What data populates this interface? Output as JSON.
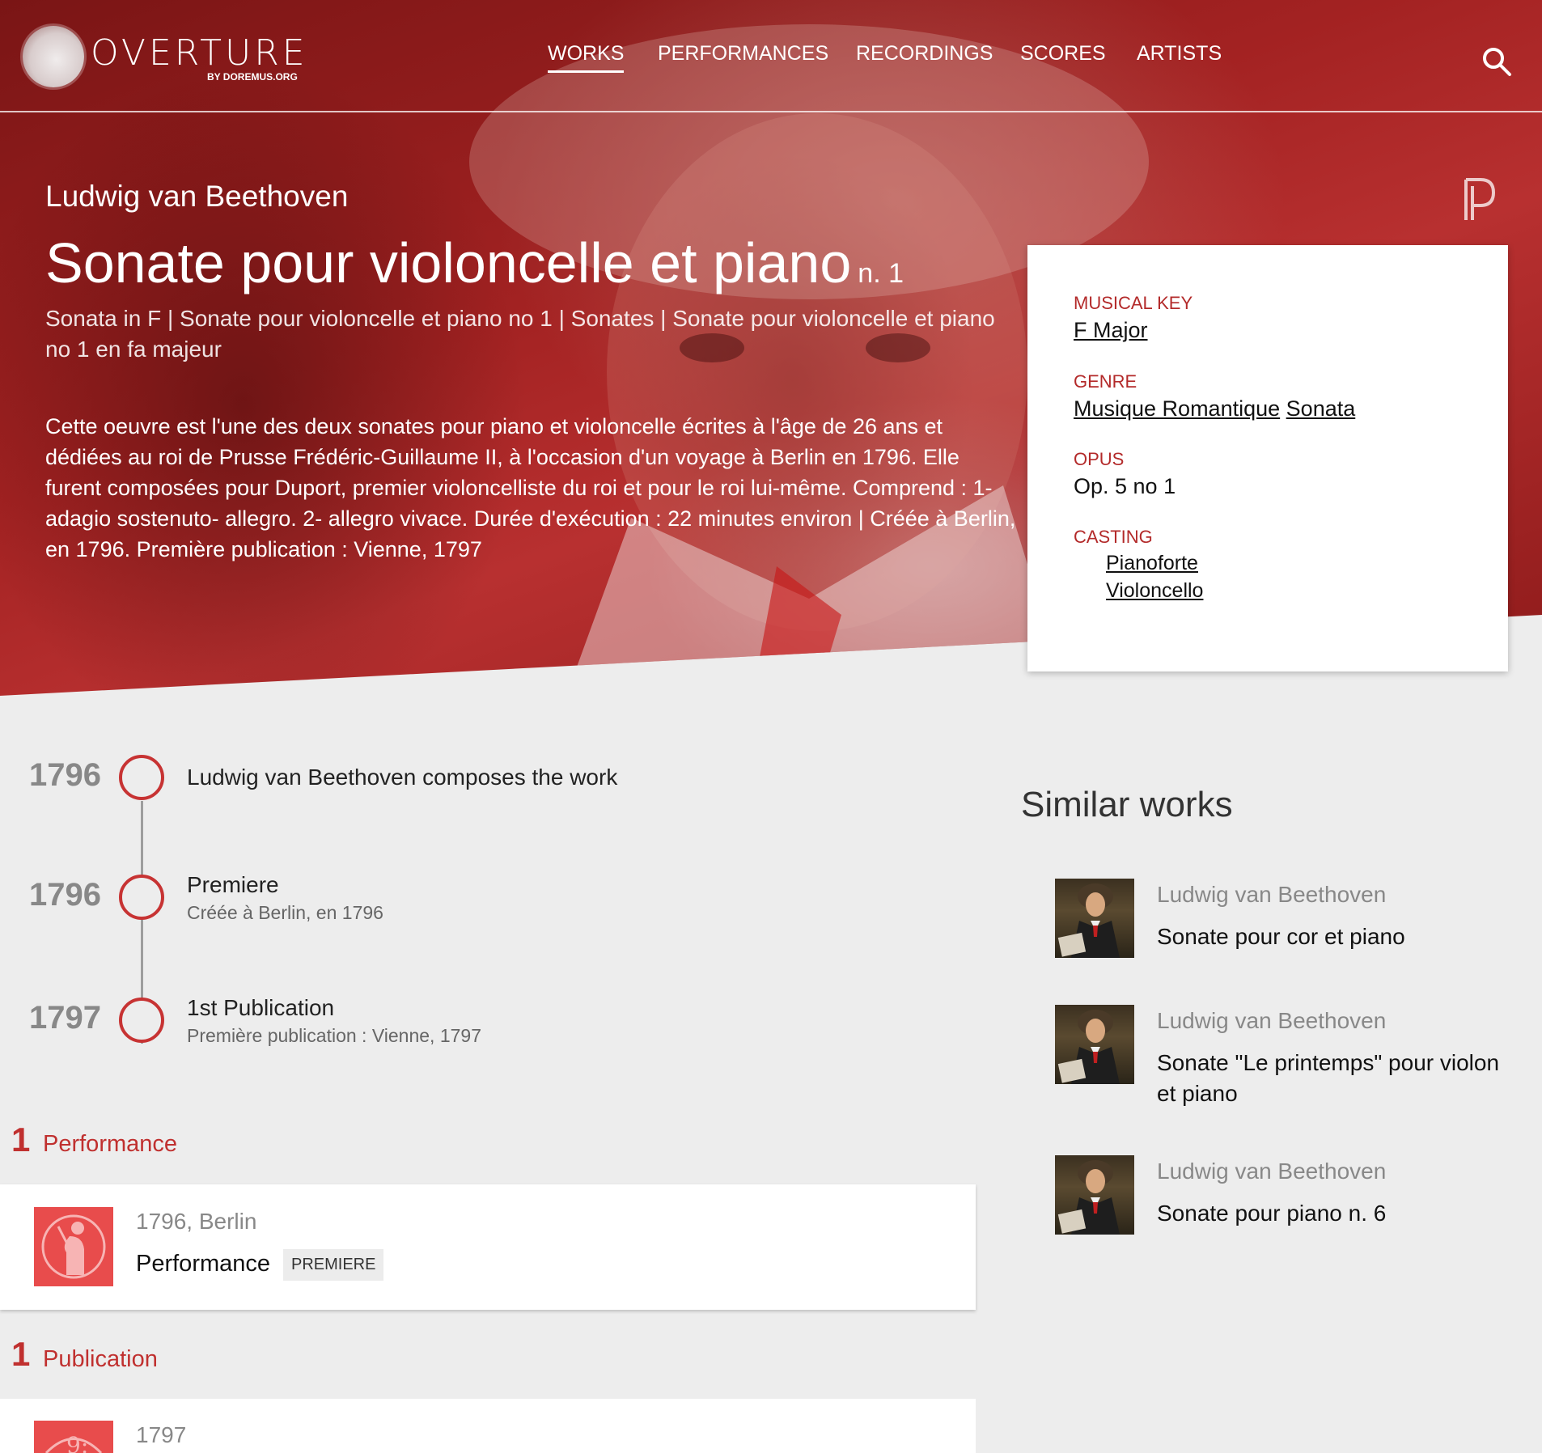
{
  "header": {
    "logo_text": "OVERTURE",
    "logo_sub": "BY DOREMUS.ORG",
    "nav": [
      {
        "label": "WORKS",
        "active": true
      },
      {
        "label": "PERFORMANCES",
        "active": false
      },
      {
        "label": "RECORDINGS",
        "active": false
      },
      {
        "label": "SCORES",
        "active": false
      },
      {
        "label": "ARTISTS",
        "active": false
      }
    ]
  },
  "work": {
    "composer": "Ludwig van Beethoven",
    "title": "Sonate pour violoncelle et piano",
    "number": "n. 1",
    "alt_titles": "Sonata in F | Sonate pour violoncelle et piano no 1 | Sonates | Sonate pour violoncelle et piano no 1 en fa majeur",
    "description": "Cette oeuvre est l'une des deux sonates pour piano et violoncelle écrites à l'âge de 26 ans et dédiées au roi de Prusse Frédéric-Guillaume II, à l'occasion d'un voyage à Berlin en 1796. Elle furent composées pour Duport, premier violoncelliste du roi et pour le roi lui-même. Comprend : 1- adagio sostenuto- allegro. 2- allegro vivace. Durée d'exécution : 22 minutes environ | Créée à Berlin, en 1796. Première publication : Vienne, 1797"
  },
  "info": {
    "key_label": "MUSICAL KEY",
    "key_value": "F Major",
    "genre_label": "GENRE",
    "genre_values": [
      "Musique Romantique",
      "Sonata"
    ],
    "opus_label": "OPUS",
    "opus_value": "Op. 5 no 1",
    "casting_label": "CASTING",
    "casting_values": [
      "Pianoforte",
      "Violoncello"
    ]
  },
  "timeline": [
    {
      "year": "1796",
      "title": "Ludwig van Beethoven composes the work",
      "sub": ""
    },
    {
      "year": "1796",
      "title": "Premiere",
      "sub": "Créée à Berlin, en 1796"
    },
    {
      "year": "1797",
      "title": "1st Publication",
      "sub": "Première publication : Vienne, 1797"
    }
  ],
  "performances": {
    "count": "1",
    "label": "Performance",
    "items": [
      {
        "meta": "1796, Berlin",
        "title": "Performance",
        "badge": "PREMIERE"
      }
    ]
  },
  "publications": {
    "count": "1",
    "label": "Publication",
    "items": [
      {
        "meta": "1797"
      }
    ]
  },
  "similar": {
    "heading": "Similar works",
    "items": [
      {
        "composer": "Ludwig van Beethoven",
        "title": "Sonate pour cor et piano"
      },
      {
        "composer": "Ludwig van Beethoven",
        "title": "Sonate \"Le printemps\" pour violon et piano"
      },
      {
        "composer": "Ludwig van Beethoven",
        "title": "Sonate pour piano n. 6"
      }
    ]
  },
  "colors": {
    "accent": "#c0302f",
    "hero": "#a32222",
    "background": "#ededed"
  }
}
